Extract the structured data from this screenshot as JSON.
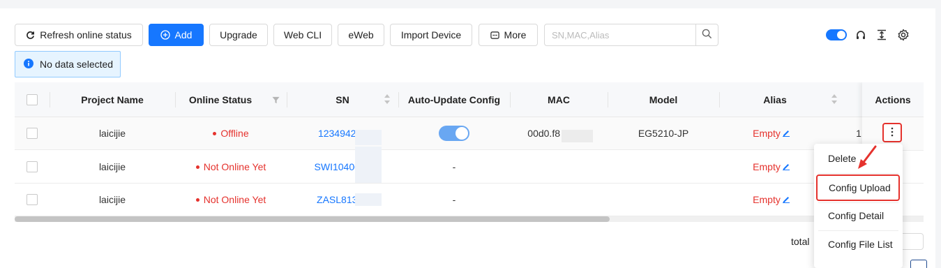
{
  "toolbar": {
    "refresh_label": "Refresh online status",
    "add_label": "Add",
    "upgrade_label": "Upgrade",
    "webcli_label": "Web CLI",
    "eweb_label": "eWeb",
    "import_label": "Import Device",
    "more_label": "More",
    "search_placeholder": "SN,MAC,Alias"
  },
  "selection_info": "No data selected",
  "table": {
    "headers": {
      "project": "Project Name",
      "online": "Online Status",
      "sn": "SN",
      "autoupdate": "Auto-Update Config",
      "mac": "MAC",
      "model": "Model",
      "alias": "Alias",
      "actions": "Actions"
    },
    "rows": [
      {
        "project": "laicijie",
        "status": "Offline",
        "sn": "123494257",
        "autoupdate": "on",
        "mac": "00d0.f8",
        "model": "EG5210-JP",
        "alias": "Empty",
        "extra": "1"
      },
      {
        "project": "laicijie",
        "status": "Not Online Yet",
        "sn": "SWI1040000",
        "autoupdate": "-",
        "mac": "",
        "model": "",
        "alias": "Empty",
        "extra": ""
      },
      {
        "project": "laicijie",
        "status": "Not Online Yet",
        "sn": "ZASL81300",
        "autoupdate": "-",
        "mac": "",
        "model": "",
        "alias": "Empty",
        "extra": ""
      }
    ]
  },
  "action_menu": {
    "delete": "Delete",
    "config_upload": "Config Upload",
    "config_detail": "Config Detail",
    "config_file_list": "Config File List"
  },
  "footer": {
    "total_label": "total"
  },
  "colors": {
    "primary": "#1677ff",
    "danger": "#e5322d",
    "info_bg": "#e6f4ff"
  }
}
